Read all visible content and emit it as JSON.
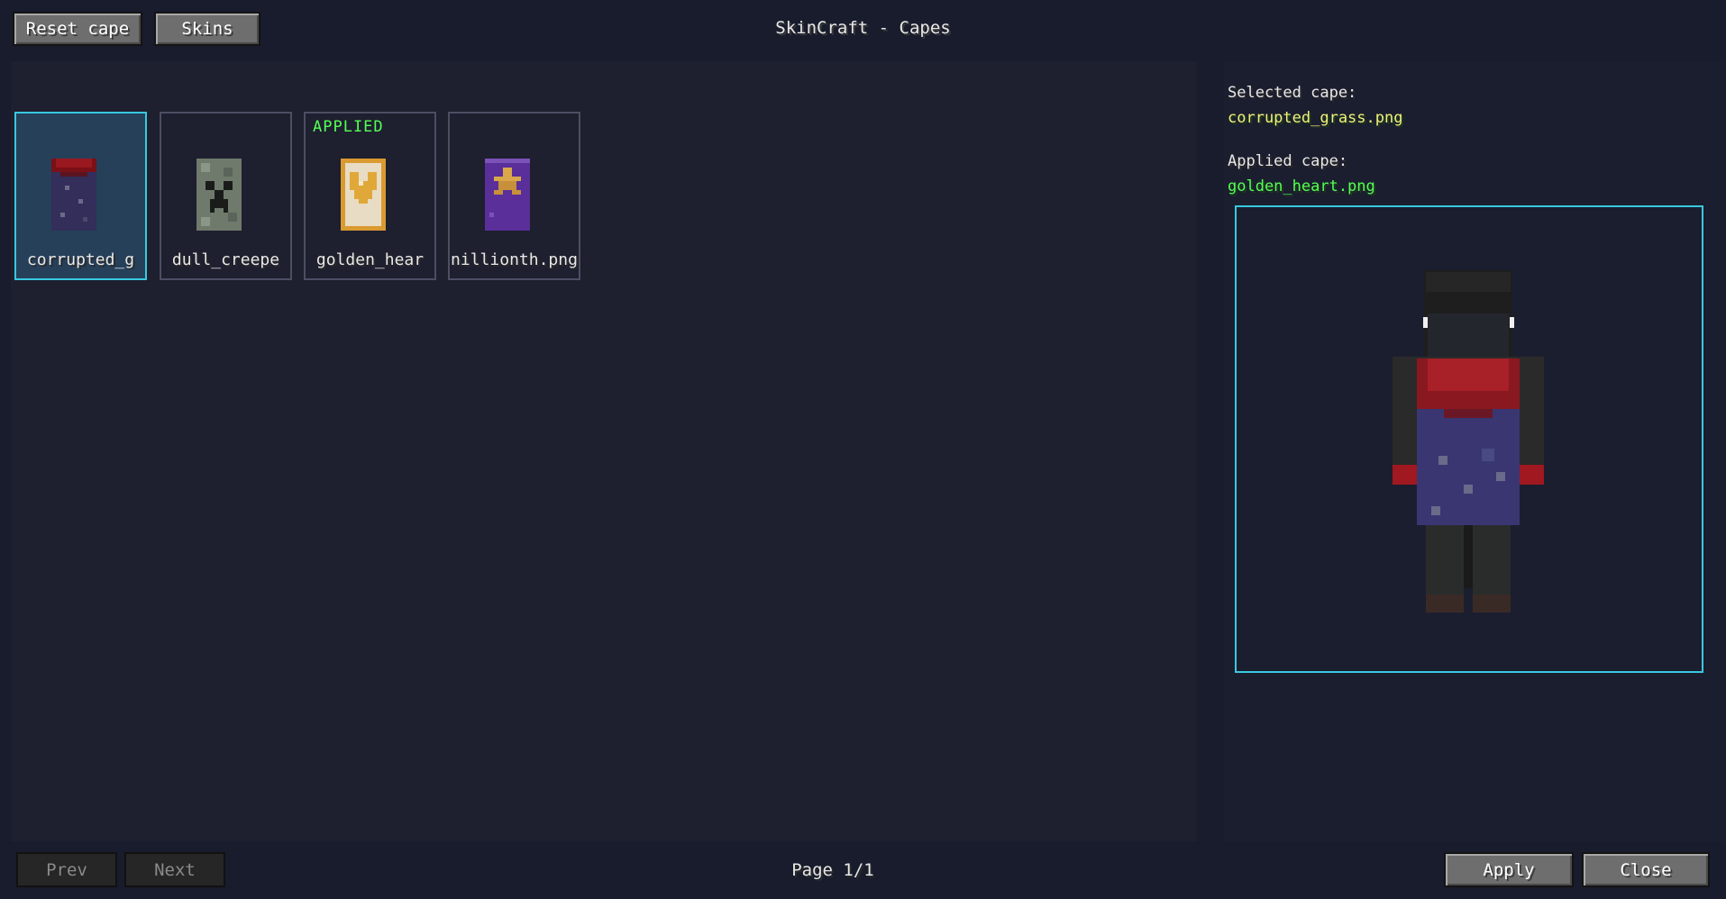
{
  "window": {
    "title": "SkinCraft - Capes"
  },
  "toolbar": {
    "reset_label": "Reset cape",
    "skins_label": "Skins"
  },
  "grid": {
    "tiles": [
      {
        "name": "corrupted_g",
        "selected": true,
        "applied_badge": "",
        "icon": "corrupted-cape-icon"
      },
      {
        "name": "dull_creepe",
        "selected": false,
        "applied_badge": "",
        "icon": "creeper-cape-icon"
      },
      {
        "name": "golden_hear",
        "selected": false,
        "applied_badge": "APPLIED",
        "icon": "golden-heart-cape-icon"
      },
      {
        "name": "nillionth.png",
        "selected": false,
        "applied_badge": "",
        "icon": "star-cape-icon"
      }
    ]
  },
  "info": {
    "selected_label": "Selected cape:",
    "selected_value": "corrupted_grass.png",
    "applied_label": "Applied cape:",
    "applied_value": "golden_heart.png"
  },
  "pagination": {
    "prev_label": "Prev",
    "next_label": "Next",
    "page_text": "Page 1/1"
  },
  "actions": {
    "apply_label": "Apply",
    "close_label": "Close"
  },
  "colors": {
    "background": "#181c2c",
    "panel": "#1e1f2f",
    "selected_border": "#38c9e0",
    "selected_value": "#f0f07a",
    "applied_value": "#55ff55"
  }
}
